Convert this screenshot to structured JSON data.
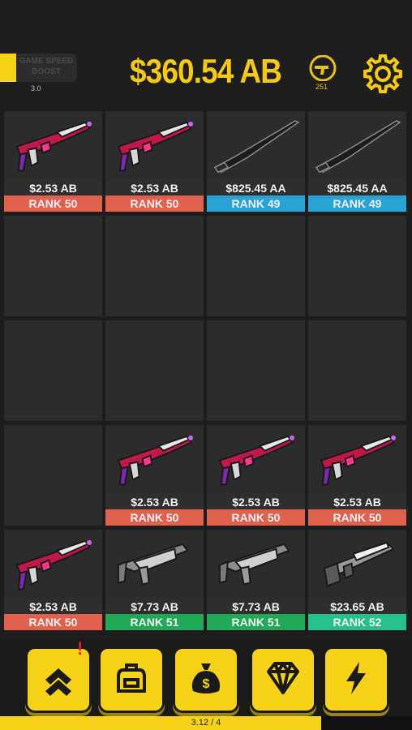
{
  "header": {
    "boost_label": "GAME SPEED BOOST",
    "boost_value": "3.0",
    "money": "$360.54 AB",
    "coin_count": "251",
    "colors": {
      "accent": "#f6c915"
    }
  },
  "rank_colors": {
    "50": "#e0624e",
    "49": "#2aa3d4",
    "51": "#23a85a",
    "52": "#27c08a"
  },
  "grid": {
    "cells": [
      {
        "weapon": "smg-pink",
        "price": "$2.53 AB",
        "rank": "RANK 50",
        "rank_level": "50"
      },
      {
        "weapon": "smg-pink",
        "price": "$2.53 AB",
        "rank": "RANK 50",
        "rank_level": "50"
      },
      {
        "weapon": "knife",
        "price": "$825.45 AA",
        "rank": "RANK 49",
        "rank_level": "49"
      },
      {
        "weapon": "knife",
        "price": "$825.45 AA",
        "rank": "RANK 49",
        "rank_level": "49"
      },
      {
        "weapon": null
      },
      {
        "weapon": null
      },
      {
        "weapon": null
      },
      {
        "weapon": null
      },
      {
        "weapon": null
      },
      {
        "weapon": null
      },
      {
        "weapon": null
      },
      {
        "weapon": null
      },
      {
        "weapon": null
      },
      {
        "weapon": "smg-pink",
        "price": "$2.53 AB",
        "rank": "RANK 50",
        "rank_level": "50"
      },
      {
        "weapon": "smg-pink",
        "price": "$2.53 AB",
        "rank": "RANK 50",
        "rank_level": "50"
      },
      {
        "weapon": "smg-pink",
        "price": "$2.53 AB",
        "rank": "RANK 50",
        "rank_level": "50"
      },
      {
        "weapon": "smg-pink",
        "price": "$2.53 AB",
        "rank": "RANK 50",
        "rank_level": "50"
      },
      {
        "weapon": "vector-gray",
        "price": "$7.73 AB",
        "rank": "RANK 51",
        "rank_level": "51"
      },
      {
        "weapon": "vector-gray",
        "price": "$7.73 AB",
        "rank": "RANK 51",
        "rank_level": "51"
      },
      {
        "weapon": "shotgun-gray",
        "price": "$23.65 AB",
        "rank": "RANK 52",
        "rank_level": "52"
      }
    ]
  },
  "bottom_nav": {
    "buttons": [
      {
        "name": "upgrade-button",
        "icon": "double-chevron-up-icon",
        "has_alert": true,
        "alert": "!"
      },
      {
        "name": "backpack-button",
        "icon": "backpack-icon"
      },
      {
        "name": "shop-button",
        "icon": "money-bag-icon"
      },
      {
        "name": "gems-button",
        "icon": "diamond-icon"
      },
      {
        "name": "boost-button",
        "icon": "lightning-icon"
      }
    ]
  },
  "progress": {
    "text": "3.12 / 4",
    "fraction": 0.78
  }
}
